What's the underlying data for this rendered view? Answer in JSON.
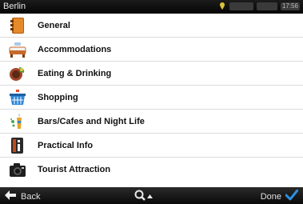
{
  "status_bar": {
    "title": "Berlin",
    "time": "17:56"
  },
  "categories": [
    {
      "label": "General",
      "icon": "book-icon"
    },
    {
      "label": "Accommodations",
      "icon": "bed-icon"
    },
    {
      "label": "Eating & Drinking",
      "icon": "food-icon"
    },
    {
      "label": "Shopping",
      "icon": "shopping-basket-icon"
    },
    {
      "label": "Bars/Cafes and Night Life",
      "icon": "drinks-icon"
    },
    {
      "label": "Practical Info",
      "icon": "info-icon"
    },
    {
      "label": "Tourist Attraction",
      "icon": "camera-icon"
    }
  ],
  "bottom_bar": {
    "back_label": "Back",
    "done_label": "Done"
  },
  "colors": {
    "done_check": "#2f8fe0",
    "bar_bg": "#111111"
  }
}
